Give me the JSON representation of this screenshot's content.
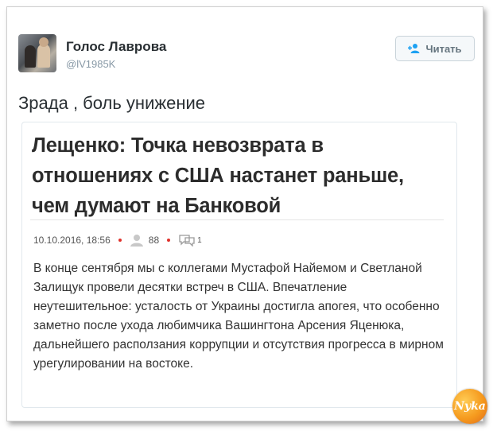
{
  "profile": {
    "name": "Голос Лаврова",
    "handle": "@lV1985K"
  },
  "follow_button": {
    "label": "Читать",
    "icon": "add-user-icon"
  },
  "tweet": {
    "text": "Зрада , боль унижение"
  },
  "article": {
    "headline": "Лещенко: Точка невозврата в отношениях с США настанет раньше, чем думают на Банковой",
    "date": "10.10.2016, 18:56",
    "views": "88",
    "comments": "1",
    "body": "В конце сентября мы с коллегами Мустафой Найемом и Светланой Залищук провели десятки встреч в США. Впечатление неутешительное: усталость от Украины достигла апогея, что особенно заметно после ухода любимчика Вашингтона Арсения Яценюка, дальнейшего расползания коррупции и отсутствия прогресса в мирном урегулировании на востоке."
  },
  "watermark": {
    "text": "Nyka"
  },
  "colors": {
    "accent_dot": "#e0312b",
    "button_text": "#66757f",
    "handle_text": "#8899a6"
  }
}
